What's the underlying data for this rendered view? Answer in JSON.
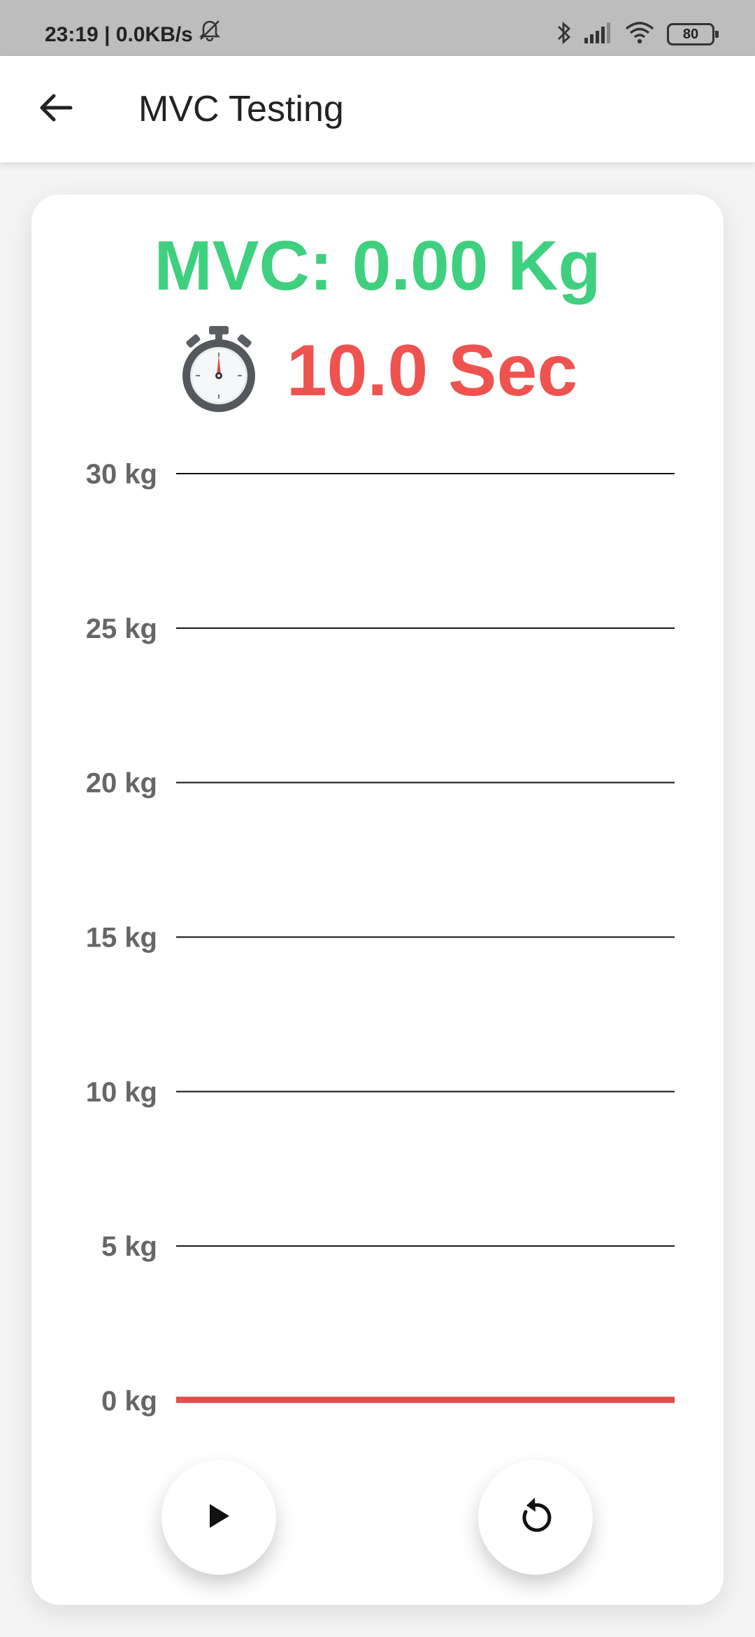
{
  "status_bar": {
    "time_speed": "23:19 | 0.0KB/s",
    "battery": "80",
    "icons": [
      "mute-icon",
      "bluetooth-icon",
      "signal-icon",
      "wifi-icon",
      "battery-icon"
    ]
  },
  "app_bar": {
    "back_icon": "arrow-back-icon",
    "title": "MVC Testing"
  },
  "readout": {
    "mvc": "MVC: 0.00 Kg",
    "timer_icon": "stopwatch-icon",
    "timer": "10.0 Sec"
  },
  "chart_data": {
    "type": "line",
    "ylabel": "",
    "xlabel": "",
    "y_ticks": [
      "0 kg",
      "5 kg",
      "10 kg",
      "15 kg",
      "20 kg",
      "25 kg",
      "30 kg"
    ],
    "ylim": [
      0,
      30
    ],
    "grid": true,
    "series": [
      {
        "color": "#e04f4a",
        "values": [
          0,
          0
        ]
      }
    ]
  },
  "controls": {
    "play_icon": "play-icon",
    "reset_icon": "replay-icon"
  },
  "colors": {
    "mvc_green": "#3ed07e",
    "timer_red": "#ee5350",
    "line_red": "#e04f4a"
  }
}
